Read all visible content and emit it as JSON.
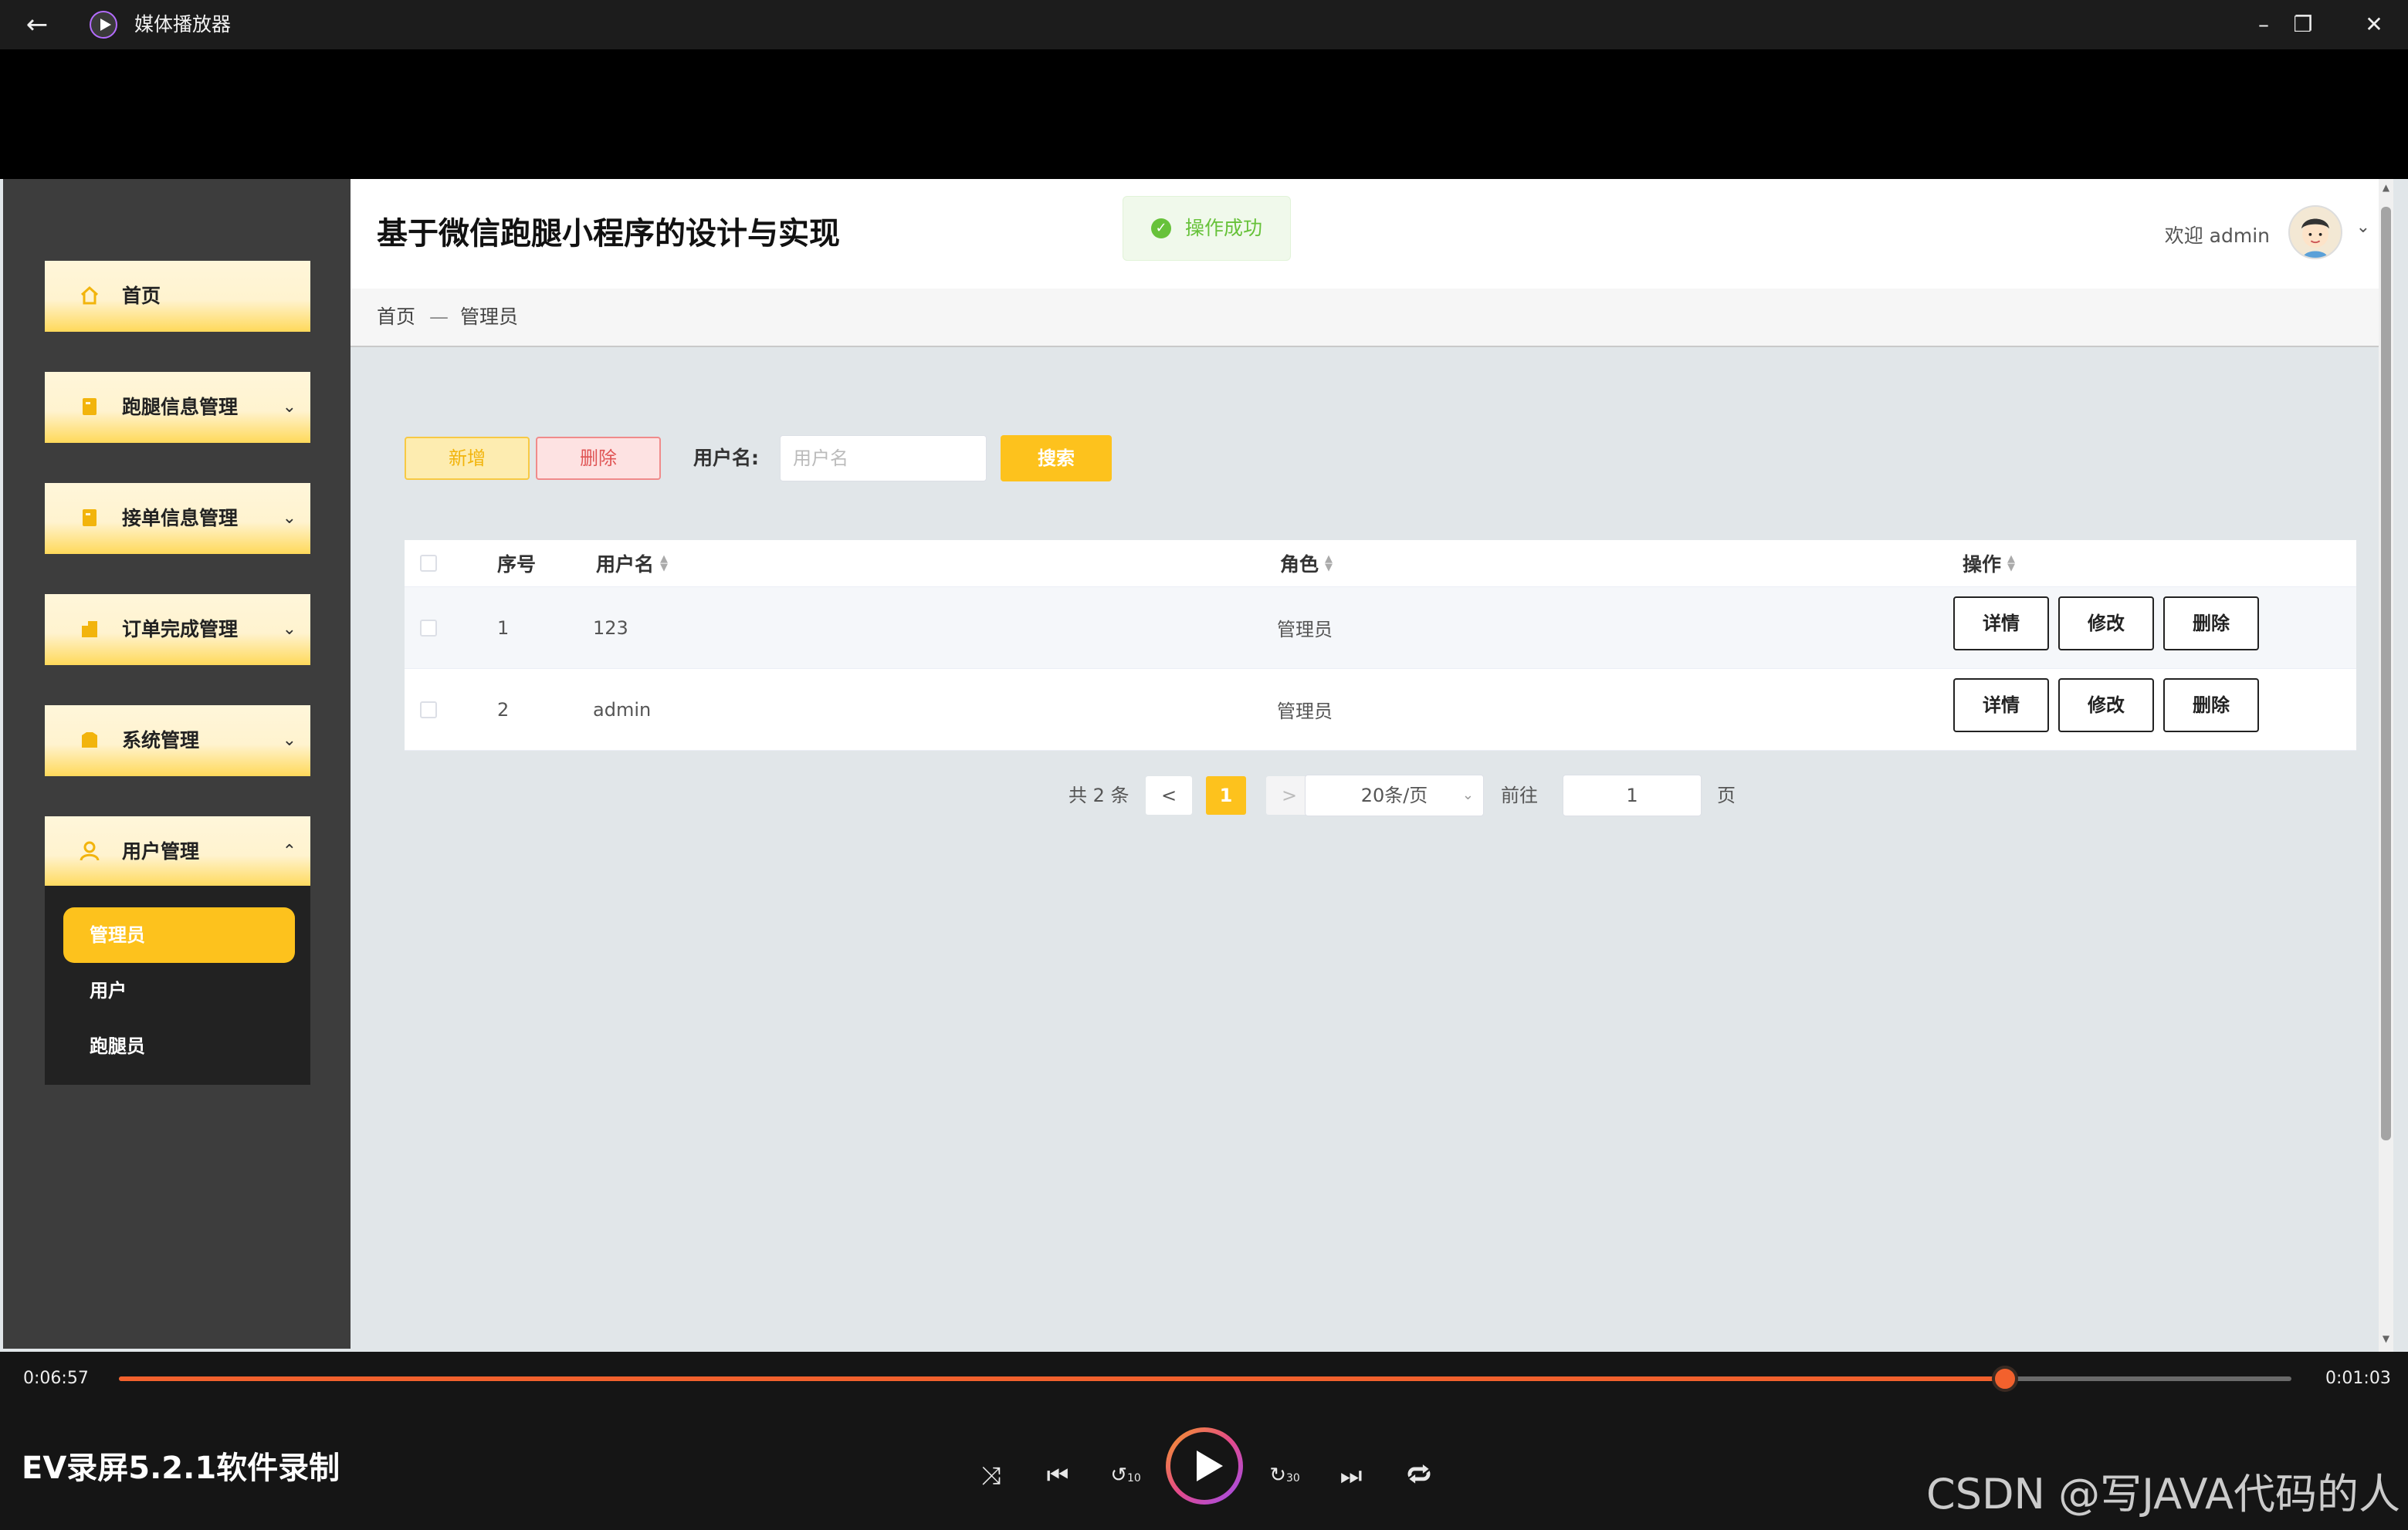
{
  "window": {
    "title": "媒体播放器",
    "back_icon": "back-arrow-icon",
    "controls": [
      "minimize-icon",
      "restore-icon",
      "close-icon"
    ]
  },
  "app": {
    "title": "基于微信跑腿小程序的设计与实现",
    "toast": "操作成功",
    "welcome": "欢迎 admin",
    "accent": "#fdc21d",
    "sidebar_bg": "#3d3d3d"
  },
  "sidebar": {
    "items": [
      {
        "label": "首页",
        "icon": "home-icon",
        "expandable": false
      },
      {
        "label": "跑腿信息管理",
        "icon": "document-icon",
        "expandable": true
      },
      {
        "label": "接单信息管理",
        "icon": "document-icon",
        "expandable": true
      },
      {
        "label": "订单完成管理",
        "icon": "building-icon",
        "expandable": true
      },
      {
        "label": "系统管理",
        "icon": "settings-box-icon",
        "expandable": true
      },
      {
        "label": "用户管理",
        "icon": "user-icon",
        "expandable": true,
        "expanded": true
      }
    ],
    "subitems": [
      {
        "label": "管理员",
        "active": true
      },
      {
        "label": "用户",
        "active": false
      },
      {
        "label": "跑腿员",
        "active": false
      }
    ]
  },
  "breadcrumb": {
    "home": "首页",
    "separator": "—",
    "current": "管理员"
  },
  "toolbar": {
    "add_label": "新增",
    "delete_label": "删除",
    "username_label": "用户名:",
    "username_value": "",
    "username_placeholder": "用户名",
    "search_label": "搜索"
  },
  "table": {
    "columns": {
      "index": "序号",
      "username": "用户名",
      "role": "角色",
      "actions": "操作"
    },
    "rows": [
      {
        "index": "1",
        "username": "123",
        "role": "管理员"
      },
      {
        "index": "2",
        "username": "admin",
        "role": "管理员"
      }
    ],
    "actions": {
      "detail": "详情",
      "edit": "修改",
      "delete": "删除"
    }
  },
  "pagination": {
    "total": "共 2 条",
    "prev": "<",
    "current_page": "1",
    "next": ">",
    "page_size": "20条/页",
    "goto_label": "前往",
    "goto_value": "1",
    "page_unit": "页"
  },
  "player": {
    "elapsed": "0:06:57",
    "remaining": "0:01:03",
    "progress": 0.868,
    "recording_title": "EV录屏5.2.1软件录制",
    "accent": "#f2612d",
    "controls": [
      "shuffle-icon",
      "previous-icon",
      "rewind-10-icon",
      "play-icon",
      "forward-30-icon",
      "next-icon",
      "repeat-icon"
    ],
    "skip_back_label": "10",
    "skip_forward_label": "30"
  },
  "watermark": "CSDN @写JAVA代码的人"
}
